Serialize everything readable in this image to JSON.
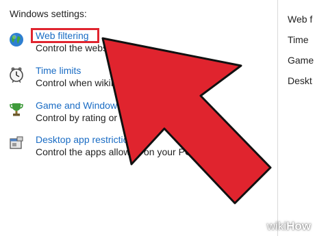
{
  "heading": "Windows settings:",
  "items": [
    {
      "label": "Web filtering",
      "description": "Control the websi",
      "icon": "globe-icon"
    },
    {
      "label": "Time limits",
      "description": "Control when wikiHow u",
      "icon": "clock-icon"
    },
    {
      "label": "Game and Windows Store ap",
      "description": "Control by rating or title",
      "icon": "trophy-icon"
    },
    {
      "label": "Desktop app restrictions",
      "description": "Control the apps allowed on your PC",
      "icon": "app-window-icon"
    }
  ],
  "right_panel": {
    "items": [
      "Web f",
      "Time",
      "Game",
      "Deskt"
    ]
  },
  "annotation": {
    "highlight_color": "#e0242e",
    "arrow_color": "#e0242e"
  },
  "watermark": {
    "wiki": "wiki",
    "how": "How"
  },
  "colors": {
    "link": "#1a6cc4",
    "text": "#222222"
  }
}
